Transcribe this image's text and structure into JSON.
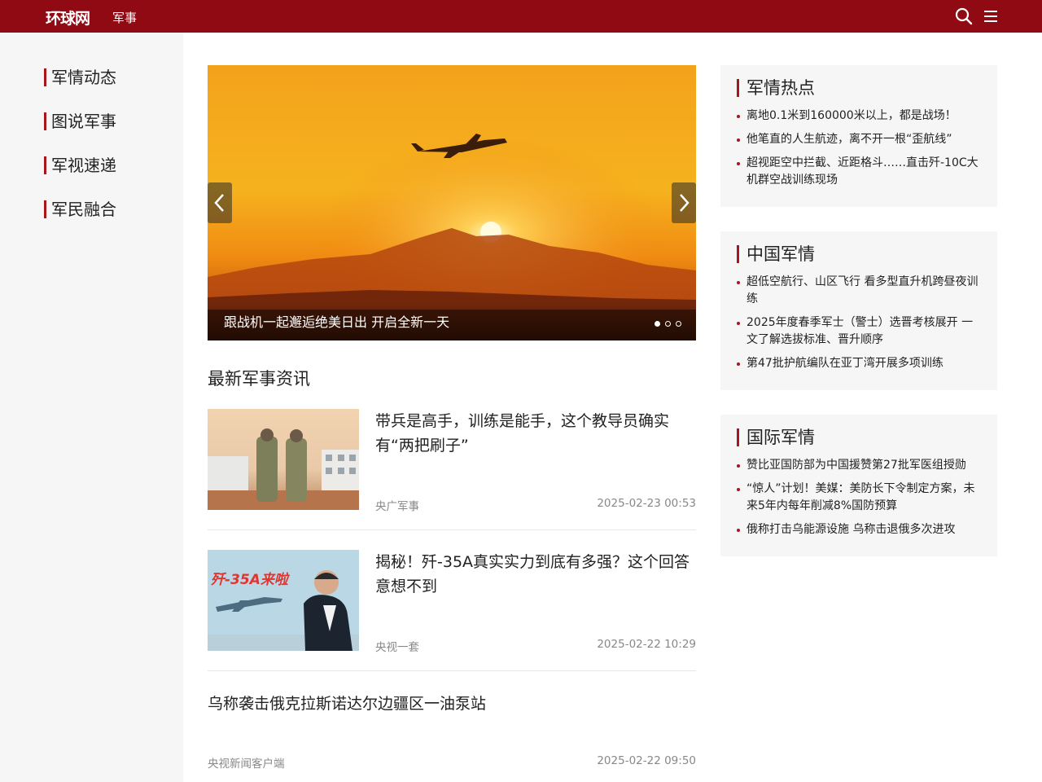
{
  "header": {
    "logo": "环球网",
    "channel": "军事",
    "search_icon": "search-icon",
    "menu_icon": "menu-icon",
    "background": "#8f0a12"
  },
  "sidebar": {
    "items": [
      {
        "label": "军情动态"
      },
      {
        "label": "图说军事"
      },
      {
        "label": "军视速递"
      },
      {
        "label": "军民融合"
      }
    ],
    "accent": "#a8151c"
  },
  "carousel": {
    "caption": "跟战机一起邂逅绝美日出 开启全新一天",
    "slide_count": 3,
    "active_slide": 1
  },
  "latest": {
    "title": "最新军事资讯",
    "items": [
      {
        "title": "带兵是高手，训练是能手，这个教导员确实有“两把刷子”",
        "source": "央广军事",
        "time": "2025-02-23 00:53"
      },
      {
        "title": "揭秘！歼-35A真实实力到底有多强？这个回答意想不到",
        "source": "央视一套",
        "time": "2025-02-22 10:29",
        "thumb_text": "歼-35A来啦"
      },
      {
        "title": "乌称袭击俄克拉斯诺达尔边疆区一油泵站",
        "source": "央视新闻客户端",
        "time": "2025-02-22 09:50"
      }
    ]
  },
  "boxes": [
    {
      "title": "军情热点",
      "items": [
        "离地0.1米到160000米以上，都是战场！",
        "他笔直的人生航迹，离不开一根“歪航线”",
        "超视距空中拦截、近距格斗……直击歼-10C大机群空战训练现场"
      ]
    },
    {
      "title": "中国军情",
      "items": [
        "超低空航行、山区飞行 看多型直升机跨昼夜训练",
        "2025年度春季军士（警士）选晋考核展开 一文了解选拔标准、晋升顺序",
        "第47批护航编队在亚丁湾开展多项训练"
      ]
    },
    {
      "title": "国际军情",
      "items": [
        "赞比亚国防部为中国援赞第27批军医组授勋",
        "“惊人”计划！美媒：美防长下令制定方案，未来5年内每年削减8%国防预算",
        "俄称打击乌能源设施 乌称击退俄多次进攻"
      ]
    }
  ]
}
